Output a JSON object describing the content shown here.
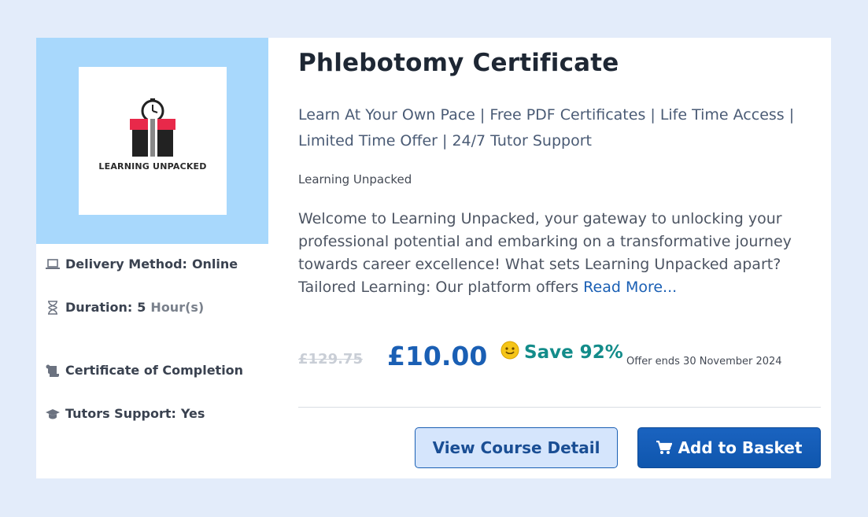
{
  "course": {
    "title": "Phlebotomy Certificate",
    "tagline": "Learn At Your Own Pace | Free PDF Certificates | Life Time Access | Limited Time Offer | 24/7 Tutor Support",
    "provider": "Learning Unpacked",
    "description": "Welcome to Learning Unpacked, your gateway to unlocking your professional potential and embarking on a transformative journey towards career excellence! What sets Learning Unpacked apart? Tailored Learning: Our platform offers ",
    "read_more": "Read More..."
  },
  "logo": {
    "text": "LEARNING UNPACKED",
    "icon": "gift-clock-logo"
  },
  "meta": {
    "delivery_label": "Delivery Method:",
    "delivery_value": "Online",
    "duration_label": "Duration:",
    "duration_value": "5",
    "duration_unit": "Hour(s)",
    "certificate_label": "Certificate of Completion",
    "tutors_label": "Tutors Support:",
    "tutors_value": "Yes"
  },
  "icons": {
    "delivery": "laptop-icon",
    "duration": "hourglass-icon",
    "certificate": "scroll-icon",
    "tutors": "graduation-cap-icon",
    "save": "smiley-icon",
    "basket": "cart-icon"
  },
  "pricing": {
    "old_price": "£129.75",
    "new_price": "£10.00",
    "save_text": "Save 92%",
    "offer_text": "Offer ends 30 November 2024"
  },
  "buttons": {
    "view_detail": "View Course Detail",
    "add_to_basket": "Add to Basket"
  },
  "colors": {
    "page_bg": "#e3ecfa",
    "thumb_bg": "#a8d8fc",
    "accent_blue": "#1a5fb4",
    "save_teal": "#138c8a"
  }
}
